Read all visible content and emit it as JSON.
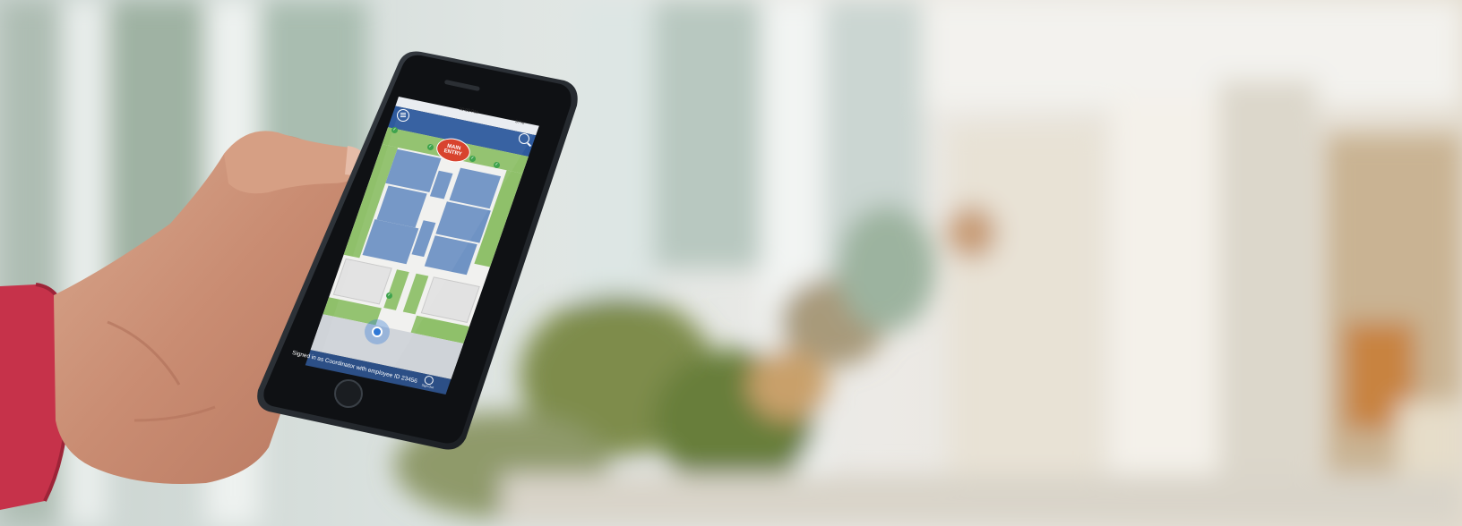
{
  "status_bar": {
    "time": "10:08 PM",
    "battery": "37%"
  },
  "map": {
    "main_entry_line1": "MAIN",
    "main_entry_line2": "ENTRY"
  },
  "footer": {
    "signed_in_text": "Signed in as Coordinator with employee ID 23456",
    "sign_out_label": "Sign Out"
  },
  "icons": {
    "menu": "menu-icon",
    "search": "search-icon",
    "checkmark": "checkmark-icon",
    "location": "location-pin-icon",
    "sign_out": "sign-out-icon"
  },
  "colors": {
    "app_header": "#2e5a9e",
    "footer_bar": "#2c4f86",
    "building_blocks": "#6f93c4",
    "grass": "#8fc06a",
    "corridor": "#f1f1ef",
    "entry_badge": "#d8432e",
    "location_dot": "#2f78d6",
    "sleeve": "#c6324a"
  }
}
